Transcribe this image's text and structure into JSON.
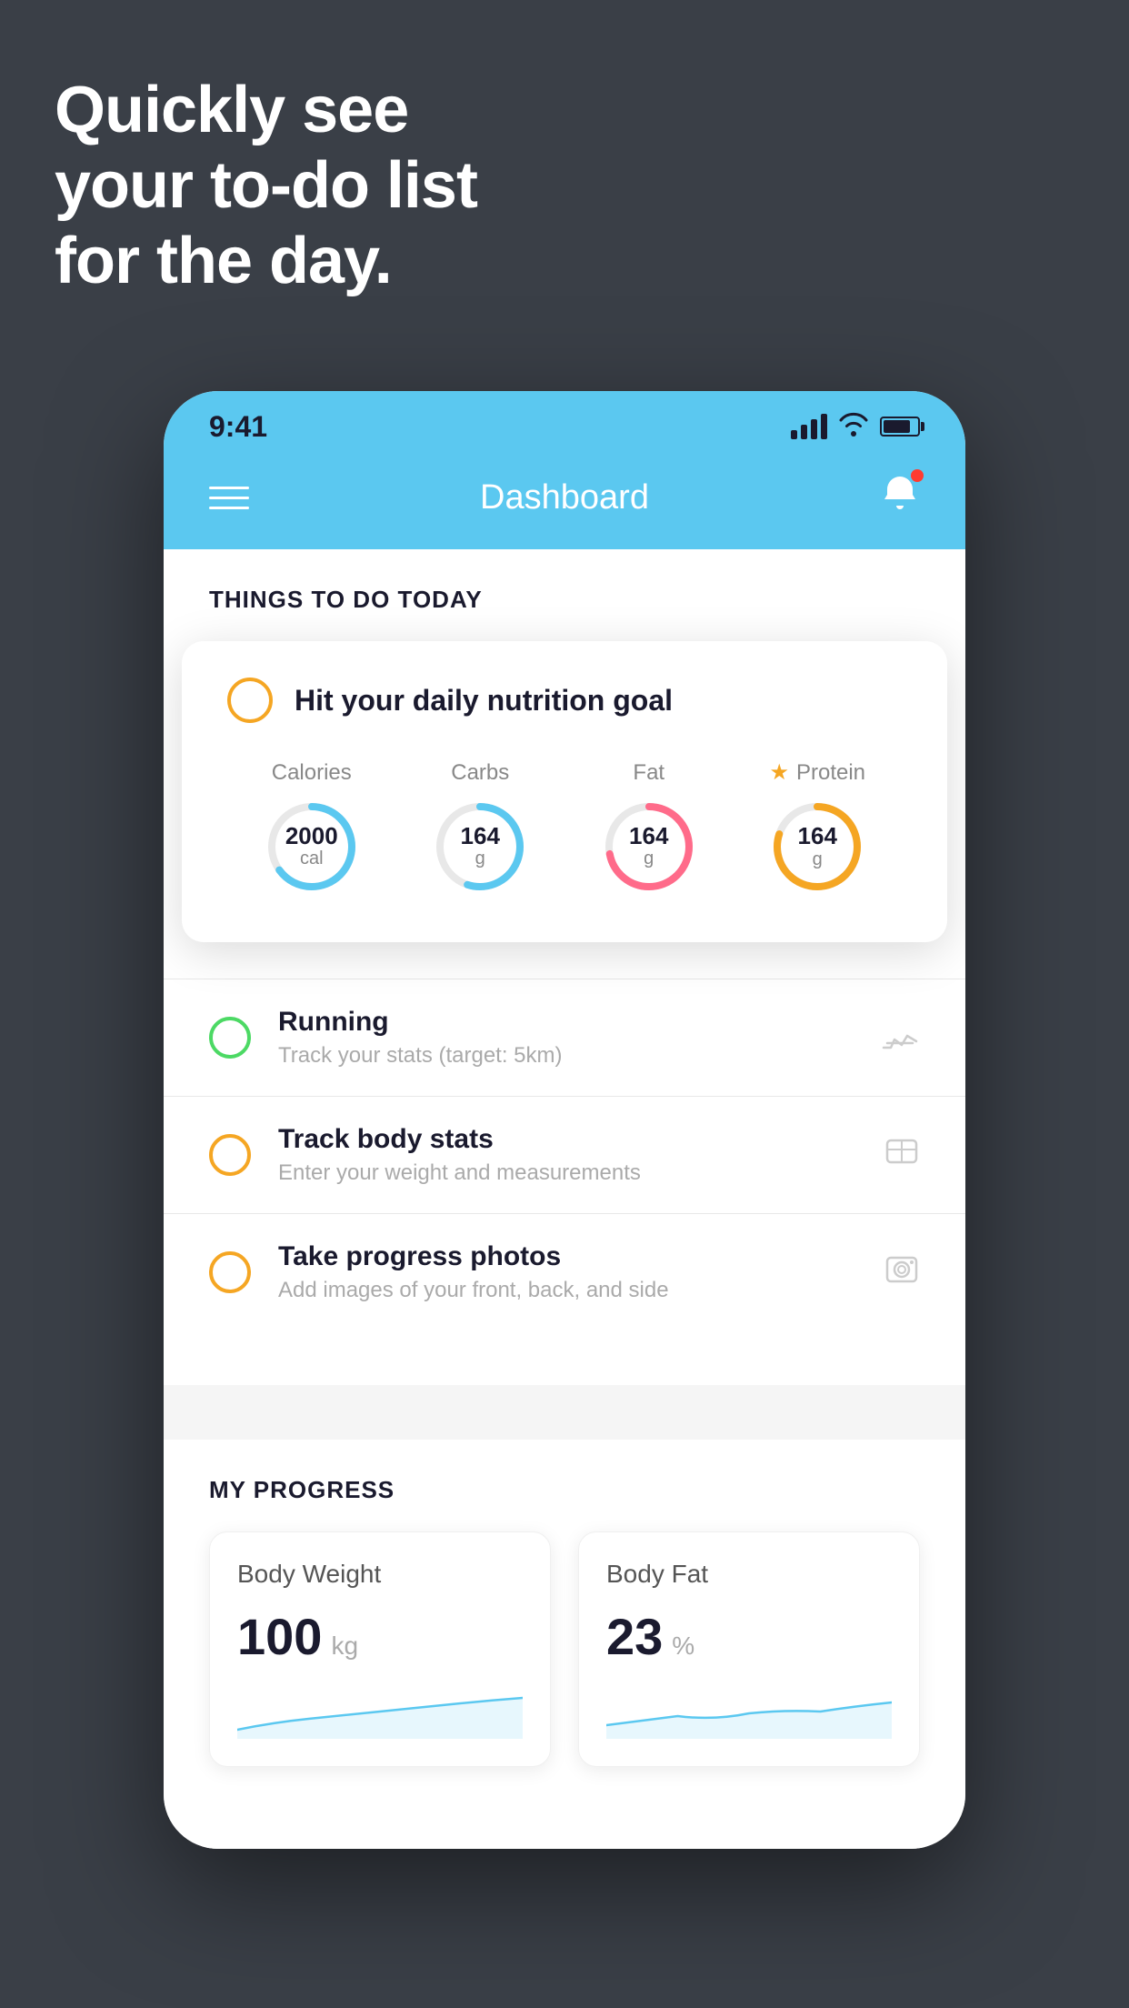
{
  "background": {
    "color": "#3a3f47"
  },
  "hero": {
    "line1": "Quickly see",
    "line2": "your to-do list",
    "line3": "for the day."
  },
  "phone": {
    "statusBar": {
      "time": "9:41"
    },
    "navBar": {
      "title": "Dashboard"
    },
    "todaySection": {
      "header": "THINGS TO DO TODAY"
    },
    "nutritionCard": {
      "checkboxColor": "yellow",
      "title": "Hit your daily nutrition goal",
      "rings": [
        {
          "label": "Calories",
          "value": "2000",
          "unit": "cal",
          "color": "blue",
          "progress": 0.65,
          "hasStar": false
        },
        {
          "label": "Carbs",
          "value": "164",
          "unit": "g",
          "color": "blue",
          "progress": 0.55,
          "hasStar": false
        },
        {
          "label": "Fat",
          "value": "164",
          "unit": "g",
          "color": "pink",
          "progress": 0.72,
          "hasStar": false
        },
        {
          "label": "Protein",
          "value": "164",
          "unit": "g",
          "color": "yellow",
          "progress": 0.8,
          "hasStar": true
        }
      ]
    },
    "todoItems": [
      {
        "id": "running",
        "checkColor": "green",
        "title": "Running",
        "subtitle": "Track your stats (target: 5km)",
        "icon": "🏃"
      },
      {
        "id": "body-stats",
        "checkColor": "yellow",
        "title": "Track body stats",
        "subtitle": "Enter your weight and measurements",
        "icon": "⚖️"
      },
      {
        "id": "progress-photos",
        "checkColor": "yellow",
        "title": "Take progress photos",
        "subtitle": "Add images of your front, back, and side",
        "icon": "👤"
      }
    ],
    "progressSection": {
      "header": "MY PROGRESS",
      "cards": [
        {
          "id": "body-weight",
          "title": "Body Weight",
          "value": "100",
          "unit": "kg"
        },
        {
          "id": "body-fat",
          "title": "Body Fat",
          "value": "23",
          "unit": "%"
        }
      ]
    }
  }
}
